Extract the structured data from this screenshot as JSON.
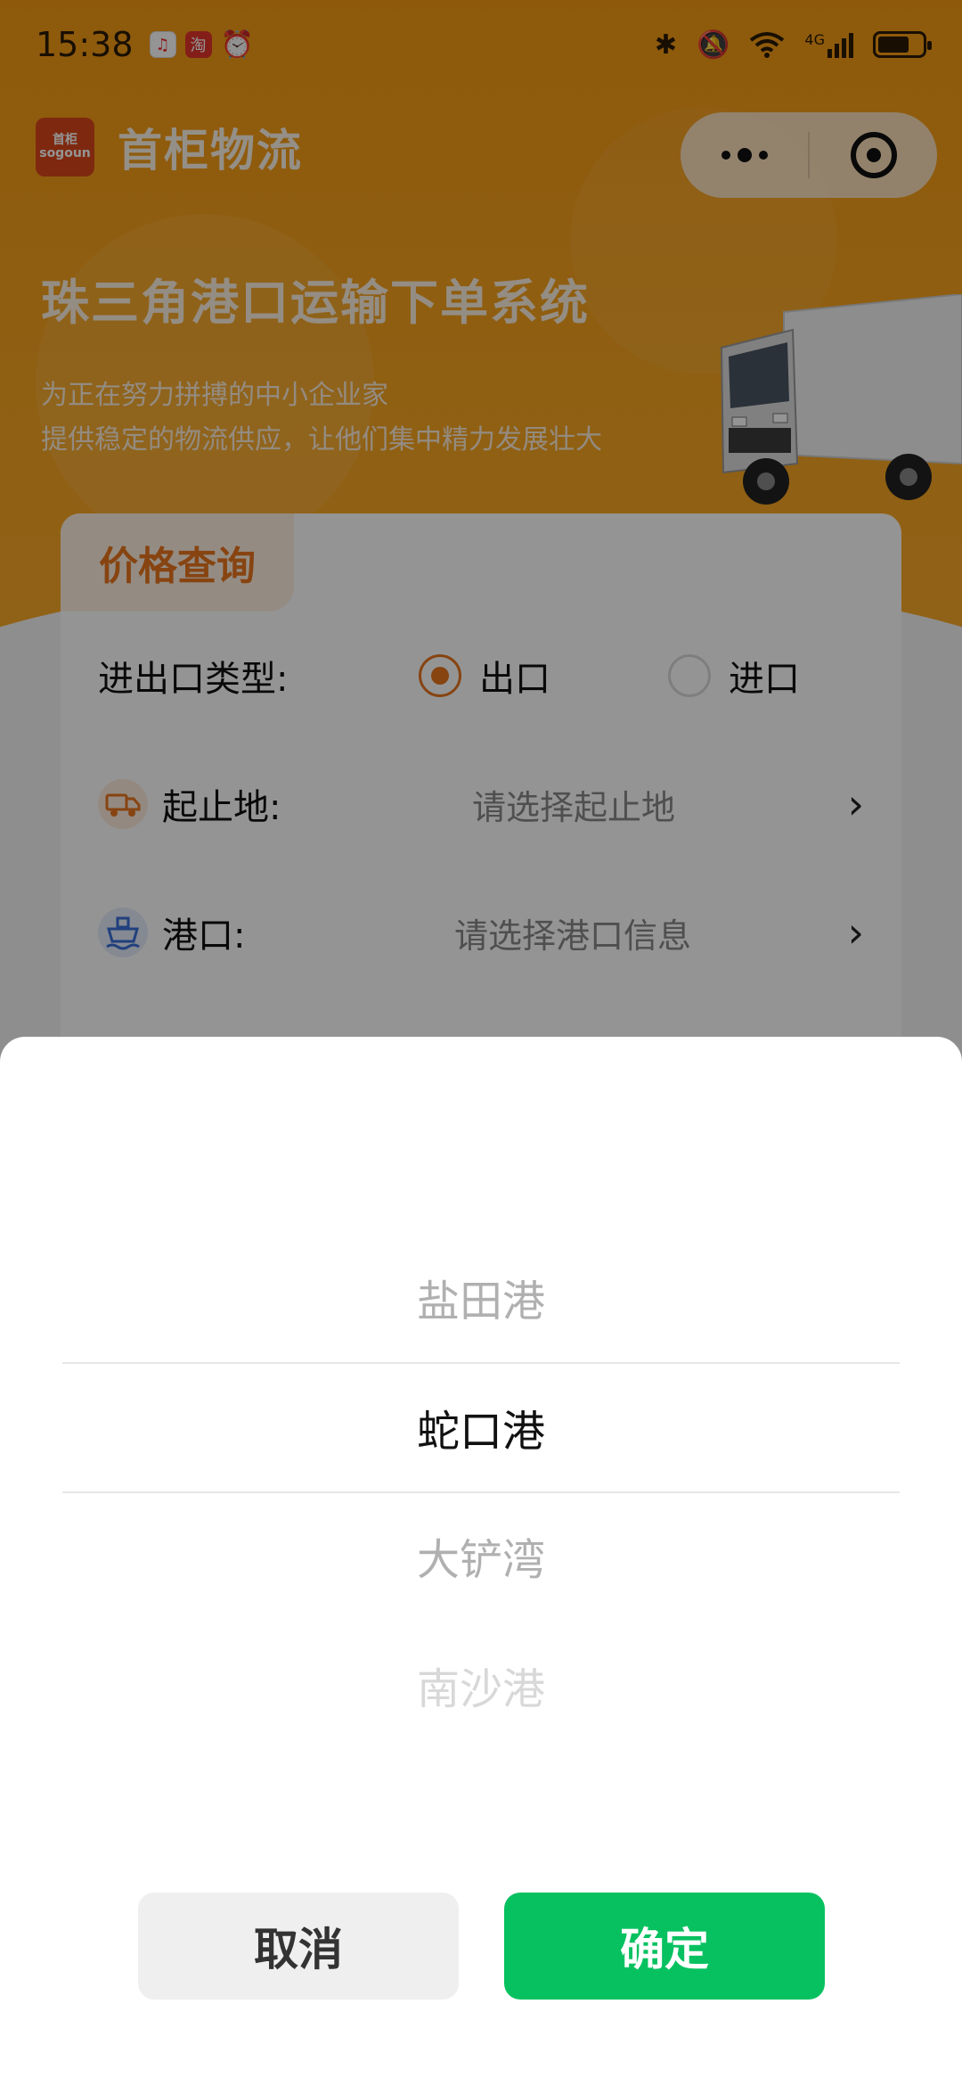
{
  "status_bar": {
    "time": "15:38",
    "network": "4G"
  },
  "header": {
    "logo_text": "sogoun",
    "logo_sub": "首柜",
    "app_title": "首柜物流"
  },
  "hero": {
    "heading": "珠三角港口运输下单系统",
    "subtitle_line1": "为正在努力拼搏的中小企业家",
    "subtitle_line2": "提供稳定的物流供应，让他们集中精力发展壮大"
  },
  "form": {
    "tab_label": "价格查询",
    "import_export_label": "进出口类型:",
    "export_option": "出口",
    "import_option": "进口",
    "selected_type": "出口",
    "origin_label": "起止地:",
    "origin_placeholder": "请选择起止地",
    "port_label": "港口:",
    "port_placeholder": "请选择港口信息"
  },
  "picker": {
    "options": [
      "盐田港",
      "蛇口港",
      "大铲湾",
      "南沙港"
    ],
    "selected": "蛇口港",
    "cancel_label": "取消",
    "confirm_label": "确定"
  },
  "colors": {
    "brand_orange": "#f59a14",
    "accent_orange": "#e8761e",
    "confirm_green": "#07c160"
  },
  "icons": {
    "truck": "truck-icon",
    "port": "ship-icon",
    "chevron": "chevron-right-icon"
  }
}
